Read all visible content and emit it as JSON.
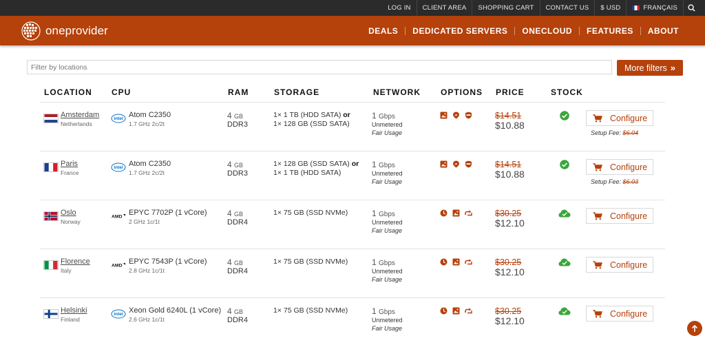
{
  "topbar": {
    "links": [
      "LOG IN",
      "CLIENT AREA",
      "SHOPPING CART",
      "CONTACT US",
      "$ USD"
    ],
    "language": "FRANÇAIS"
  },
  "brand": {
    "name": "oneprovider"
  },
  "nav": [
    "DEALS",
    "DEDICATED SERVERS",
    "ONECLOUD",
    "FEATURES",
    "ABOUT"
  ],
  "filter": {
    "placeholder": "Filter by locations",
    "more_filters": "More filters"
  },
  "columns": [
    "LOCATION",
    "CPU",
    "RAM",
    "STORAGE",
    "NETWORK",
    "OPTIONS",
    "PRICE",
    "STOCK"
  ],
  "colors": {
    "accent": "#b5410b",
    "topbar": "#2b2b2b",
    "stock_green": "#3aa63a"
  },
  "rows": [
    {
      "city": "Amsterdam",
      "country": "Netherlands",
      "flag": "nl",
      "cpu_brand": "intel",
      "cpu": "Atom C2350",
      "cpu_spec": "1.7 GHz 2c/2t",
      "ram_size": "4",
      "ram_unit": "GB",
      "ram_type": "DDR3",
      "storage_a": "1× 1 TB (HDD SATA)",
      "storage_or": "or",
      "storage_b": "1× 128 GB (SSD SATA)",
      "net_speed": "1",
      "net_unit": "Gbps",
      "net_meter": "Unmetered",
      "net_fair": "Fair Usage",
      "options": [
        "image-icon",
        "ip-icon",
        "shield-icon"
      ],
      "old_price": "$14.51",
      "new_price": "$10.88",
      "stock": "check",
      "configure": "Configure",
      "setup_label": "Setup Fee:",
      "setup_fee": "$6.04"
    },
    {
      "city": "Paris",
      "country": "France",
      "flag": "fr",
      "cpu_brand": "intel",
      "cpu": "Atom C2350",
      "cpu_spec": "1.7 GHz 2c/2t",
      "ram_size": "4",
      "ram_unit": "GB",
      "ram_type": "DDR3",
      "storage_a": "1× 128 GB (SSD SATA)",
      "storage_or": "or",
      "storage_b": "1× 1 TB (HDD SATA)",
      "net_speed": "1",
      "net_unit": "Gbps",
      "net_meter": "Unmetered",
      "net_fair": "Fair Usage",
      "options": [
        "image-icon",
        "ip-icon",
        "shield-icon"
      ],
      "old_price": "$14.51",
      "new_price": "$10.88",
      "stock": "check",
      "configure": "Configure",
      "setup_label": "Setup Fee:",
      "setup_fee": "$6.03"
    },
    {
      "city": "Oslo",
      "country": "Norway",
      "flag": "no",
      "cpu_brand": "amd",
      "cpu": "EPYC 7702P (1 vCore)",
      "cpu_spec": "2 GHz 1c/1t",
      "ram_size": "4",
      "ram_unit": "GB",
      "ram_type": "DDR4",
      "storage_a": "1× 75 GB (SSD NVMe)",
      "storage_or": "",
      "storage_b": "",
      "net_speed": "1",
      "net_unit": "Gbps",
      "net_meter": "Unmetered",
      "net_fair": "Fair Usage",
      "options": [
        "clock-icon",
        "image-icon",
        "arrow-icon"
      ],
      "old_price": "$30.25",
      "new_price": "$12.10",
      "stock": "cloud",
      "configure": "Configure",
      "setup_label": "",
      "setup_fee": ""
    },
    {
      "city": "Florence",
      "country": "Italy",
      "flag": "it",
      "cpu_brand": "amd",
      "cpu": "EPYC 7543P (1 vCore)",
      "cpu_spec": "2.8 GHz 1c/1t",
      "ram_size": "4",
      "ram_unit": "GB",
      "ram_type": "DDR4",
      "storage_a": "1× 75 GB (SSD NVMe)",
      "storage_or": "",
      "storage_b": "",
      "net_speed": "1",
      "net_unit": "Gbps",
      "net_meter": "Unmetered",
      "net_fair": "Fair Usage",
      "options": [
        "clock-icon",
        "image-icon",
        "arrow-icon"
      ],
      "old_price": "$30.25",
      "new_price": "$12.10",
      "stock": "cloud",
      "configure": "Configure",
      "setup_label": "",
      "setup_fee": ""
    },
    {
      "city": "Helsinki",
      "country": "Finland",
      "flag": "fi",
      "cpu_brand": "intel",
      "cpu": "Xeon Gold 6240L (1 vCore)",
      "cpu_spec": "2.6 GHz 1c/1t",
      "ram_size": "4",
      "ram_unit": "GB",
      "ram_type": "DDR4",
      "storage_a": "1× 75 GB (SSD NVMe)",
      "storage_or": "",
      "storage_b": "",
      "net_speed": "1",
      "net_unit": "Gbps",
      "net_meter": "Unmetered",
      "net_fair": "Fair Usage",
      "options": [
        "clock-icon",
        "image-icon",
        "arrow-icon"
      ],
      "old_price": "$30.25",
      "new_price": "$12.10",
      "stock": "cloud",
      "configure": "Configure",
      "setup_label": "",
      "setup_fee": ""
    }
  ]
}
